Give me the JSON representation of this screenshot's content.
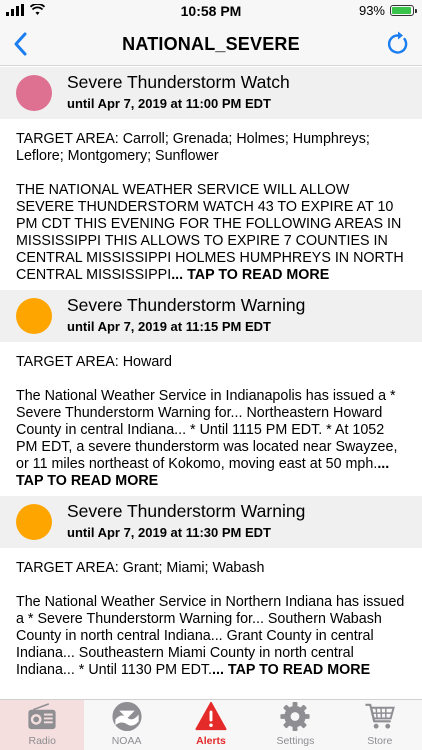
{
  "status": {
    "time": "10:58 PM",
    "battery": "93%",
    "battery_level": 0.93
  },
  "nav": {
    "title": "NATIONAL_SEVERE"
  },
  "alerts": [
    {
      "title": "Severe Thunderstorm Watch",
      "until": "until Apr 7, 2019 at 11:00 PM EDT",
      "color": "#de7092",
      "target": "TARGET AREA: Carroll; Grenada; Holmes; Humphreys; Leflore; Montgomery; Sunflower",
      "description": "THE NATIONAL WEATHER SERVICE WILL ALLOW SEVERE THUNDERSTORM WATCH 43 TO EXPIRE AT 10 PM CDT THIS EVENING FOR THE FOLLOWING AREAS IN MISSISSIPPI THIS ALLOWS TO EXPIRE 7 COUNTIES IN CENTRAL MISSISSIPPI HOLMES HUMPHREYS IN NORTH CENTRAL MISSISSIPPI",
      "more": "... TAP TO READ MORE"
    },
    {
      "title": "Severe Thunderstorm Warning",
      "until": "until Apr 7, 2019 at 11:15 PM EDT",
      "color": "#ffa500",
      "target": "TARGET AREA: Howard",
      "description": "The National Weather Service in Indianapolis has issued a * Severe Thunderstorm Warning for... Northeastern Howard County in central Indiana... * Until 1115 PM EDT. * At 1052 PM EDT, a severe thunderstorm was located near Swayzee, or 11 miles northeast of Kokomo, moving east at 50 mph.",
      "more": "... TAP TO READ MORE"
    },
    {
      "title": "Severe Thunderstorm Warning",
      "until": "until Apr 7, 2019 at 11:30 PM EDT",
      "color": "#ffa500",
      "target": "TARGET AREA: Grant; Miami; Wabash",
      "description": "The National Weather Service in Northern Indiana has issued a * Severe Thunderstorm Warning for... Southern Wabash County in north central Indiana... Grant County in central Indiana... Southeastern Miami County in north central Indiana... * Until 1130 PM EDT.",
      "more": "... TAP TO READ MORE"
    }
  ],
  "tabs": [
    {
      "label": "Radio",
      "icon": "radio-icon"
    },
    {
      "label": "NOAA",
      "icon": "noaa-logo-icon"
    },
    {
      "label": "Alerts",
      "icon": "warning-icon"
    },
    {
      "label": "Settings",
      "icon": "gear-icon"
    },
    {
      "label": "Store",
      "icon": "cart-icon"
    }
  ],
  "colors": {
    "accent": "#1a7df0",
    "active_tab": "#e52a2a"
  }
}
